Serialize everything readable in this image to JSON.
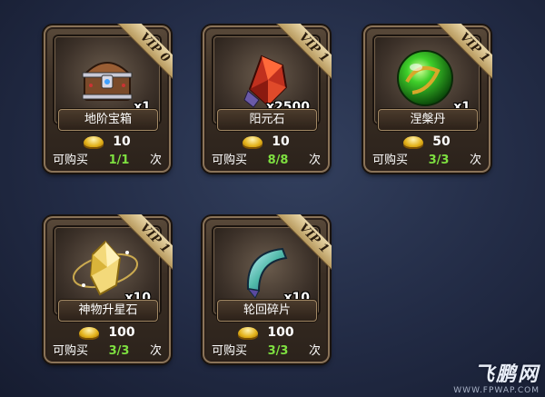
{
  "items": [
    {
      "vip": "VIP 0",
      "name": "地阶宝箱",
      "qty": "x1",
      "price": "10",
      "limit_label": "可购买",
      "count": "1/1",
      "unit": "次",
      "icon": "treasure-chest-icon"
    },
    {
      "vip": "VIP 1",
      "name": "阳元石",
      "qty": "x2500",
      "price": "10",
      "limit_label": "可购买",
      "count": "8/8",
      "unit": "次",
      "icon": "red-crystal-icon"
    },
    {
      "vip": "VIP 1",
      "name": "涅槃丹",
      "qty": "x1",
      "price": "50",
      "limit_label": "可购买",
      "count": "3/3",
      "unit": "次",
      "icon": "green-orb-icon"
    },
    {
      "vip": "VIP 1",
      "name": "神物升星石",
      "qty": "x10",
      "price": "100",
      "limit_label": "可购买",
      "count": "3/3",
      "unit": "次",
      "icon": "gold-star-stone-icon"
    },
    {
      "vip": "VIP 1",
      "name": "轮回碎片",
      "qty": "x10",
      "price": "100",
      "limit_label": "可购买",
      "count": "3/3",
      "unit": "次",
      "icon": "jade-fragment-icon"
    }
  ],
  "watermark": {
    "logo": "飞鹏网",
    "url": "WWW.FPWAP.COM"
  },
  "colors": {
    "count_green": "#7ee040",
    "gold": "#e3b21b",
    "frame_border": "#8a7358"
  }
}
